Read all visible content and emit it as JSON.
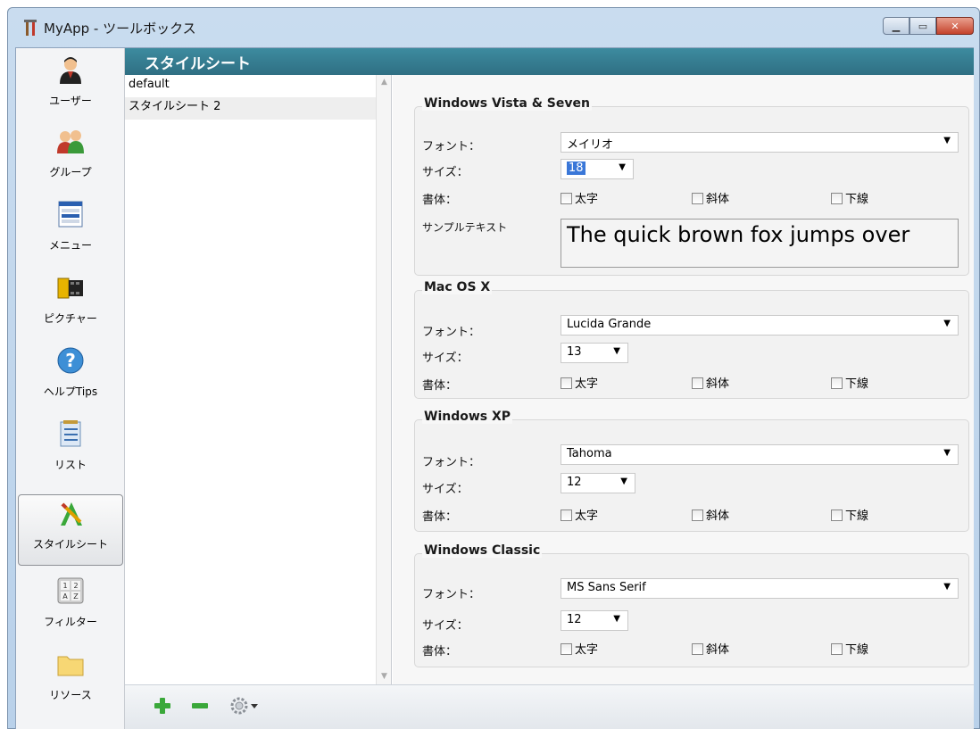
{
  "window": {
    "title": "MyApp - ツールボックス",
    "min_icon": "minimize-icon",
    "max_icon": "maximize-icon",
    "close_icon": "close-icon"
  },
  "toolbar": {
    "items": [
      {
        "label": "ユーザー",
        "icon": "user-icon"
      },
      {
        "label": "グループ",
        "icon": "group-icon"
      },
      {
        "label": "メニュー",
        "icon": "menu-icon"
      },
      {
        "label": "ピクチャー",
        "icon": "picture-icon"
      },
      {
        "label": "ヘルプTips",
        "icon": "help-icon"
      },
      {
        "label": "リスト",
        "icon": "list-icon"
      },
      {
        "label": "スタイルシート",
        "icon": "stylesheet-icon",
        "selected": true
      },
      {
        "label": "フィルター",
        "icon": "filter-icon"
      },
      {
        "label": "リソース",
        "icon": "folder-icon"
      }
    ]
  },
  "header": {
    "title": "スタイルシート"
  },
  "stylesheets": {
    "items": [
      "default",
      "スタイルシート 2"
    ],
    "selected_index": 1
  },
  "labels": {
    "font": "フォント：",
    "size": "サイズ：",
    "style": "書体：",
    "sample": "サンプルテキスト",
    "bold": "太字",
    "italic": "斜体",
    "underline": "下線"
  },
  "groups": [
    {
      "title": "Windows Vista & Seven",
      "font": "メイリオ",
      "size": "18"
    },
    {
      "title": "Mac OS X",
      "font": "Lucida Grande",
      "size": "13"
    },
    {
      "title": "Windows XP",
      "font": "Tahoma",
      "size": "12"
    },
    {
      "title": "Windows Classic",
      "font": "MS Sans Serif",
      "size": "12"
    }
  ],
  "sample_text": "The quick brown fox jumps over",
  "bottombar": {
    "add_icon": "add-icon",
    "remove_icon": "remove-icon",
    "gear_icon": "gear-icon"
  },
  "colors": {
    "header_bg": "#2f6f83",
    "accent": "#3a77d8",
    "add_green": "#3aa83a"
  }
}
